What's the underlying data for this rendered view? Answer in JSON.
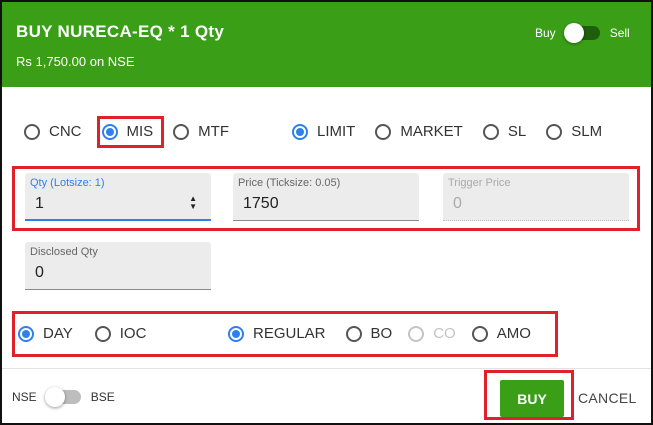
{
  "header": {
    "title": "BUY NURECA-EQ * 1 Qty",
    "subtitle": "Rs 1,750.00 on NSE",
    "buy_label": "Buy",
    "sell_label": "Sell",
    "side_toggle_state": "Buy",
    "bg_color": "#3a9f17"
  },
  "product_types": [
    {
      "label": "CNC",
      "selected": false
    },
    {
      "label": "MIS",
      "selected": true
    },
    {
      "label": "MTF",
      "selected": false
    }
  ],
  "order_types": [
    {
      "label": "LIMIT",
      "selected": true
    },
    {
      "label": "MARKET",
      "selected": false
    },
    {
      "label": "SL",
      "selected": false
    },
    {
      "label": "SLM",
      "selected": false
    }
  ],
  "fields": {
    "qty": {
      "label": "Qty (Lotsize: 1)",
      "value": "1"
    },
    "price": {
      "label": "Price (Ticksize: 0.05)",
      "value": "1750"
    },
    "trigger": {
      "label": "Trigger Price",
      "value": "0"
    },
    "disclosed": {
      "label": "Disclosed Qty",
      "value": "0"
    }
  },
  "validity": [
    {
      "label": "DAY",
      "selected": true
    },
    {
      "label": "IOC",
      "selected": false
    }
  ],
  "variety": [
    {
      "label": "REGULAR",
      "selected": true,
      "disabled": false
    },
    {
      "label": "BO",
      "selected": false,
      "disabled": false
    },
    {
      "label": "CO",
      "selected": false,
      "disabled": true
    },
    {
      "label": "AMO",
      "selected": false,
      "disabled": false
    }
  ],
  "footer": {
    "nse_label": "NSE",
    "bse_label": "BSE",
    "exchange_toggle_state": "NSE",
    "buy_button": "BUY",
    "cancel_button": "CANCEL"
  },
  "colors": {
    "accent": "#2f80ed",
    "buy_green": "#3a9f17",
    "highlight_red": "#e0202a"
  }
}
